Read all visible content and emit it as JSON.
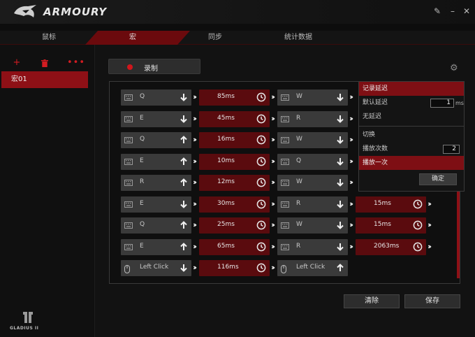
{
  "app": {
    "title": "ARMOURY"
  },
  "tabs": [
    {
      "label": "鼠标",
      "active": false
    },
    {
      "label": "宏",
      "active": true
    },
    {
      "label": "同步",
      "active": false
    },
    {
      "label": "统计数据",
      "active": false
    }
  ],
  "sidebar": {
    "icons": [
      "plus-icon",
      "trash-icon",
      "more-icon"
    ],
    "macros": [
      {
        "label": "宏01",
        "selected": true
      }
    ],
    "device_logo_text": "GLADIUS II"
  },
  "toolbar": {
    "record_label": "录制"
  },
  "macro_rows": [
    {
      "left_key": "Q",
      "left_dir": "down",
      "delay": "85ms",
      "right_key": "W",
      "right_dir": "down",
      "right_delay": ""
    },
    {
      "left_key": "E",
      "left_dir": "down",
      "delay": "45ms",
      "right_key": "R",
      "right_dir": "down",
      "right_delay": ""
    },
    {
      "left_key": "Q",
      "left_dir": "up",
      "delay": "16ms",
      "right_key": "W",
      "right_dir": "down",
      "right_delay": ""
    },
    {
      "left_key": "E",
      "left_dir": "up",
      "delay": "10ms",
      "right_key": "Q",
      "right_dir": "down",
      "right_delay": ""
    },
    {
      "left_key": "R",
      "left_dir": "up",
      "delay": "12ms",
      "right_key": "W",
      "right_dir": "down",
      "right_delay": ""
    },
    {
      "left_key": "E",
      "left_dir": "down",
      "delay": "30ms",
      "right_key": "R",
      "right_dir": "down",
      "right_delay": "15ms"
    },
    {
      "left_key": "Q",
      "left_dir": "up",
      "delay": "25ms",
      "right_key": "W",
      "right_dir": "down",
      "right_delay": "15ms"
    },
    {
      "left_key": "E",
      "left_dir": "up",
      "delay": "65ms",
      "right_key": "R",
      "right_dir": "down",
      "right_delay": "2063ms"
    },
    {
      "left_key": "Left Click",
      "left_dir": "down",
      "delay": "116ms",
      "right_key": "Left Click",
      "right_dir": "up",
      "right_delay": "",
      "mouse": true
    }
  ],
  "popup": {
    "record_delay": "记录延迟",
    "default_delay": "默认延迟",
    "default_delay_value": "1",
    "default_delay_unit": "ms",
    "no_delay": "无延迟",
    "toggle": "切换",
    "play_count": "播放次数",
    "play_count_value": "2",
    "play_once": "播放一次",
    "ok": "确定"
  },
  "actions": {
    "clear": "清除",
    "save": "保存"
  },
  "colors": {
    "accent": "#8e1016",
    "delay_bg": "#5a0b0e",
    "key_bg": "#3a3a3a"
  }
}
